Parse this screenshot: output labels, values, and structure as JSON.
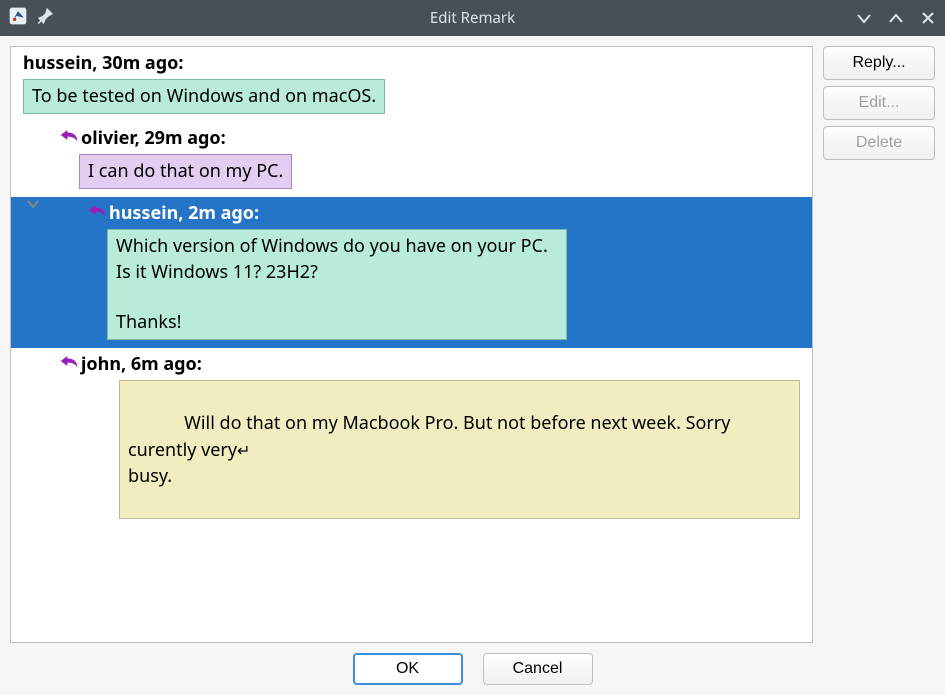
{
  "window": {
    "title": "Edit Remark"
  },
  "buttons": {
    "reply": "Reply...",
    "edit": "Edit...",
    "delete": "Delete",
    "ok": "OK",
    "cancel": "Cancel"
  },
  "thread": {
    "root": {
      "header": "hussein, 30m ago:",
      "body": "To be tested on Windows and on macOS."
    },
    "reply1": {
      "header": "olivier, 29m ago:",
      "body": "I can do that on my PC."
    },
    "reply2": {
      "header": "hussein, 2m ago:",
      "body": "Which version of Windows do you have on your PC.\nIs it Windows 11? 23H2?\n\nThanks!"
    },
    "reply3": {
      "header": "john, 6m ago:",
      "body_line1": "Will do that on my Macbook Pro. But not before next week. Sorry curently very",
      "body_line2": "busy."
    }
  }
}
